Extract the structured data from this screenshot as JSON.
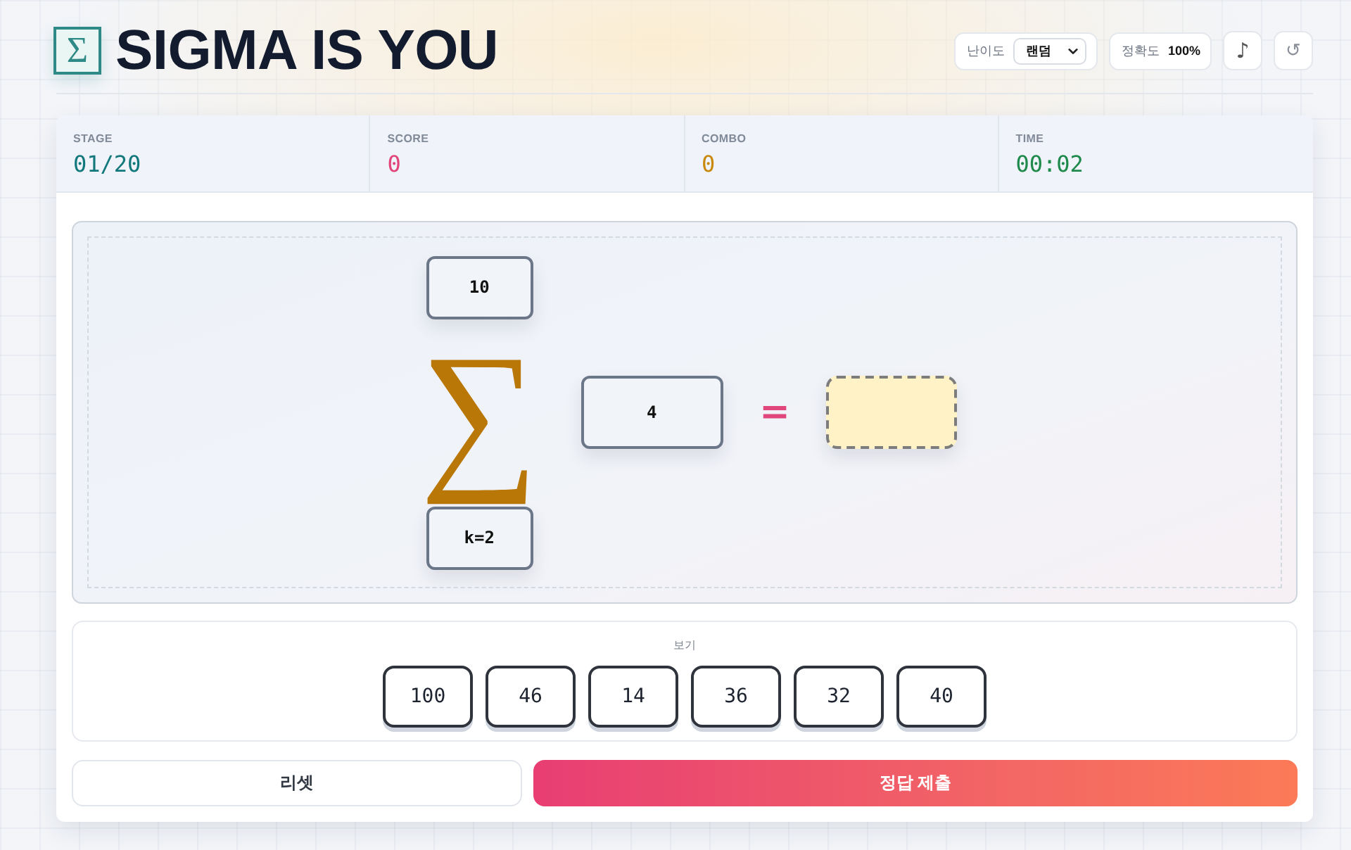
{
  "header": {
    "logo": "Σ",
    "title": "SIGMA IS YOU",
    "difficulty": {
      "label": "난이도",
      "value": "랜덤"
    },
    "accuracy": {
      "label": "정확도",
      "value": "100%"
    },
    "sound_button": "♪",
    "restart_button": "↺"
  },
  "stats": [
    {
      "label": "STAGE",
      "value": "01/20",
      "color": "#12787c"
    },
    {
      "label": "SCORE",
      "value": "0",
      "color": "#e2457a"
    },
    {
      "label": "COMBO",
      "value": "0",
      "color": "#c98a0c"
    },
    {
      "label": "TIME",
      "value": "00:02",
      "color": "#1f8a4c"
    }
  ],
  "puzzle": {
    "upper": "10",
    "operator": "∑",
    "lower": "k=2",
    "term": "4",
    "equals": "="
  },
  "options": {
    "label": "보기",
    "items": [
      {
        "value": "100",
        "selected": false
      },
      {
        "value": "46",
        "selected": false
      },
      {
        "value": "14",
        "selected": false
      },
      {
        "value": "36",
        "selected": false
      },
      {
        "value": "32",
        "selected": false
      },
      {
        "value": "40",
        "selected": false
      }
    ]
  },
  "actions": [
    {
      "kind": "reset",
      "label": "리셋"
    },
    {
      "kind": "submit",
      "label": "정답 제출"
    }
  ]
}
